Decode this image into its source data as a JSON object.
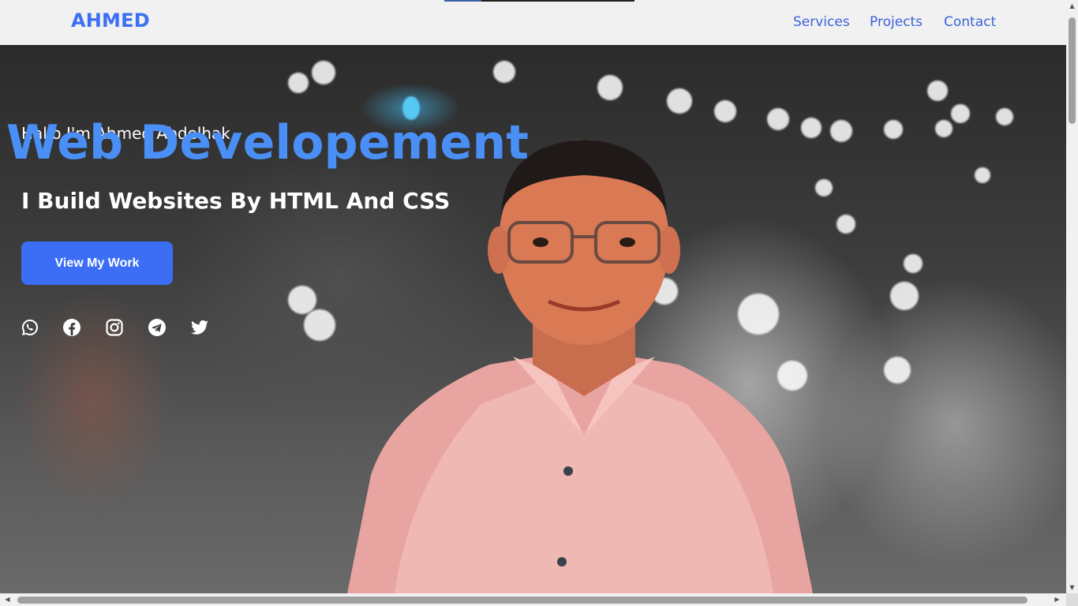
{
  "navbar": {
    "brand": "AHMED",
    "links": [
      "Services",
      "Projects",
      "Contact"
    ]
  },
  "hero": {
    "greeting": "Hallo I'm Ahmed Abdelhak",
    "headline": "Web Developement",
    "subheadline": "I Build Websites By HTML And CSS",
    "cta_label": "View My Work",
    "social_icons": [
      "whatsapp-icon",
      "facebook-icon",
      "instagram-icon",
      "telegram-icon",
      "twitter-icon"
    ]
  },
  "colors": {
    "accent": "#3b6ef5",
    "headline": "#4a8ff5",
    "nav_link": "#3b63d9"
  }
}
